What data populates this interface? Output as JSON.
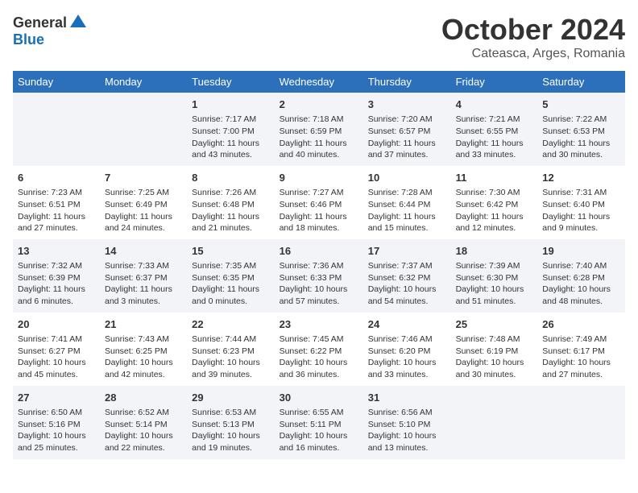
{
  "logo": {
    "general": "General",
    "blue": "Blue"
  },
  "title": "October 2024",
  "subtitle": "Cateasca, Arges, Romania",
  "weekdays": [
    "Sunday",
    "Monday",
    "Tuesday",
    "Wednesday",
    "Thursday",
    "Friday",
    "Saturday"
  ],
  "weeks": [
    [
      {
        "day": "",
        "info": ""
      },
      {
        "day": "",
        "info": ""
      },
      {
        "day": "1",
        "info": "Sunrise: 7:17 AM\nSunset: 7:00 PM\nDaylight: 11 hours and 43 minutes."
      },
      {
        "day": "2",
        "info": "Sunrise: 7:18 AM\nSunset: 6:59 PM\nDaylight: 11 hours and 40 minutes."
      },
      {
        "day": "3",
        "info": "Sunrise: 7:20 AM\nSunset: 6:57 PM\nDaylight: 11 hours and 37 minutes."
      },
      {
        "day": "4",
        "info": "Sunrise: 7:21 AM\nSunset: 6:55 PM\nDaylight: 11 hours and 33 minutes."
      },
      {
        "day": "5",
        "info": "Sunrise: 7:22 AM\nSunset: 6:53 PM\nDaylight: 11 hours and 30 minutes."
      }
    ],
    [
      {
        "day": "6",
        "info": "Sunrise: 7:23 AM\nSunset: 6:51 PM\nDaylight: 11 hours and 27 minutes."
      },
      {
        "day": "7",
        "info": "Sunrise: 7:25 AM\nSunset: 6:49 PM\nDaylight: 11 hours and 24 minutes."
      },
      {
        "day": "8",
        "info": "Sunrise: 7:26 AM\nSunset: 6:48 PM\nDaylight: 11 hours and 21 minutes."
      },
      {
        "day": "9",
        "info": "Sunrise: 7:27 AM\nSunset: 6:46 PM\nDaylight: 11 hours and 18 minutes."
      },
      {
        "day": "10",
        "info": "Sunrise: 7:28 AM\nSunset: 6:44 PM\nDaylight: 11 hours and 15 minutes."
      },
      {
        "day": "11",
        "info": "Sunrise: 7:30 AM\nSunset: 6:42 PM\nDaylight: 11 hours and 12 minutes."
      },
      {
        "day": "12",
        "info": "Sunrise: 7:31 AM\nSunset: 6:40 PM\nDaylight: 11 hours and 9 minutes."
      }
    ],
    [
      {
        "day": "13",
        "info": "Sunrise: 7:32 AM\nSunset: 6:39 PM\nDaylight: 11 hours and 6 minutes."
      },
      {
        "day": "14",
        "info": "Sunrise: 7:33 AM\nSunset: 6:37 PM\nDaylight: 11 hours and 3 minutes."
      },
      {
        "day": "15",
        "info": "Sunrise: 7:35 AM\nSunset: 6:35 PM\nDaylight: 11 hours and 0 minutes."
      },
      {
        "day": "16",
        "info": "Sunrise: 7:36 AM\nSunset: 6:33 PM\nDaylight: 10 hours and 57 minutes."
      },
      {
        "day": "17",
        "info": "Sunrise: 7:37 AM\nSunset: 6:32 PM\nDaylight: 10 hours and 54 minutes."
      },
      {
        "day": "18",
        "info": "Sunrise: 7:39 AM\nSunset: 6:30 PM\nDaylight: 10 hours and 51 minutes."
      },
      {
        "day": "19",
        "info": "Sunrise: 7:40 AM\nSunset: 6:28 PM\nDaylight: 10 hours and 48 minutes."
      }
    ],
    [
      {
        "day": "20",
        "info": "Sunrise: 7:41 AM\nSunset: 6:27 PM\nDaylight: 10 hours and 45 minutes."
      },
      {
        "day": "21",
        "info": "Sunrise: 7:43 AM\nSunset: 6:25 PM\nDaylight: 10 hours and 42 minutes."
      },
      {
        "day": "22",
        "info": "Sunrise: 7:44 AM\nSunset: 6:23 PM\nDaylight: 10 hours and 39 minutes."
      },
      {
        "day": "23",
        "info": "Sunrise: 7:45 AM\nSunset: 6:22 PM\nDaylight: 10 hours and 36 minutes."
      },
      {
        "day": "24",
        "info": "Sunrise: 7:46 AM\nSunset: 6:20 PM\nDaylight: 10 hours and 33 minutes."
      },
      {
        "day": "25",
        "info": "Sunrise: 7:48 AM\nSunset: 6:19 PM\nDaylight: 10 hours and 30 minutes."
      },
      {
        "day": "26",
        "info": "Sunrise: 7:49 AM\nSunset: 6:17 PM\nDaylight: 10 hours and 27 minutes."
      }
    ],
    [
      {
        "day": "27",
        "info": "Sunrise: 6:50 AM\nSunset: 5:16 PM\nDaylight: 10 hours and 25 minutes."
      },
      {
        "day": "28",
        "info": "Sunrise: 6:52 AM\nSunset: 5:14 PM\nDaylight: 10 hours and 22 minutes."
      },
      {
        "day": "29",
        "info": "Sunrise: 6:53 AM\nSunset: 5:13 PM\nDaylight: 10 hours and 19 minutes."
      },
      {
        "day": "30",
        "info": "Sunrise: 6:55 AM\nSunset: 5:11 PM\nDaylight: 10 hours and 16 minutes."
      },
      {
        "day": "31",
        "info": "Sunrise: 6:56 AM\nSunset: 5:10 PM\nDaylight: 10 hours and 13 minutes."
      },
      {
        "day": "",
        "info": ""
      },
      {
        "day": "",
        "info": ""
      }
    ]
  ]
}
